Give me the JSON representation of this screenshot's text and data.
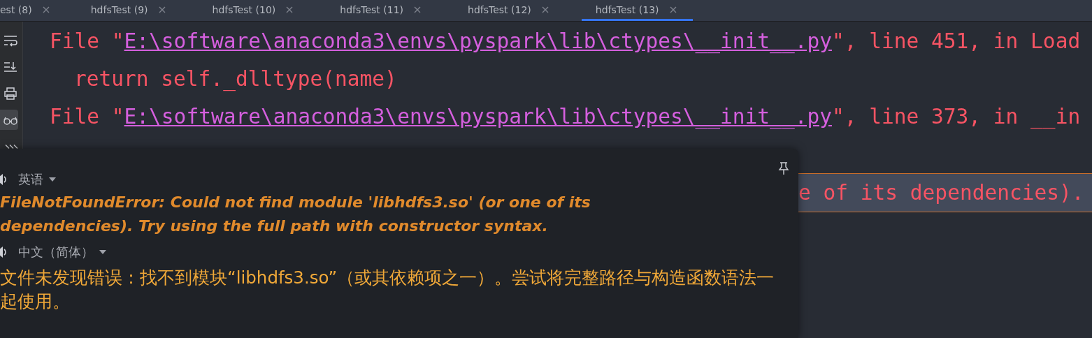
{
  "tabs": [
    {
      "label": "est (8)",
      "selected": false
    },
    {
      "label": "hdfsTest (9)",
      "selected": false
    },
    {
      "label": "hdfsTest (10)",
      "selected": false
    },
    {
      "label": "hdfsTest (11)",
      "selected": false
    },
    {
      "label": "hdfsTest (12)",
      "selected": false
    },
    {
      "label": "hdfsTest (13)",
      "selected": true
    }
  ],
  "gutter": [
    {
      "kind": "wrap",
      "selected": false
    },
    {
      "kind": "scroll-end",
      "selected": false
    },
    {
      "kind": "print",
      "selected": false
    },
    {
      "kind": "glasses",
      "selected": true
    },
    {
      "kind": "more",
      "selected": false
    }
  ],
  "console": [
    {
      "kind": "location",
      "prefix": "File \"",
      "link": "E:\\software\\anaconda3\\envs\\pyspark\\lib\\ctypes\\__init__.py",
      "suffix": "\", line 451, in Load"
    },
    {
      "kind": "source",
      "text": "return self._dlltype(name)"
    },
    {
      "kind": "location",
      "prefix": "File \"",
      "link": "E:\\software\\anaconda3\\envs\\pyspark\\lib\\ctypes\\__init__.py",
      "suffix": "\", line 373, in __in"
    },
    {
      "kind": "blank"
    },
    {
      "kind": "error",
      "text": "e of its dependencies)."
    }
  ],
  "translation": {
    "sections": [
      {
        "language": "英语",
        "text": "FileNotFoundError: Could not find module 'libhdfs3.so' (or one of its dependencies). Try using the full path with constructor syntax.",
        "kind": "source"
      },
      {
        "language": "中文（简体）",
        "text": "文件未发现错误：找不到模块“libhdfs3.so”（或其依赖项之一）。尝试将完整路径与构造函数语法一起使用。",
        "kind": "target"
      }
    ]
  }
}
